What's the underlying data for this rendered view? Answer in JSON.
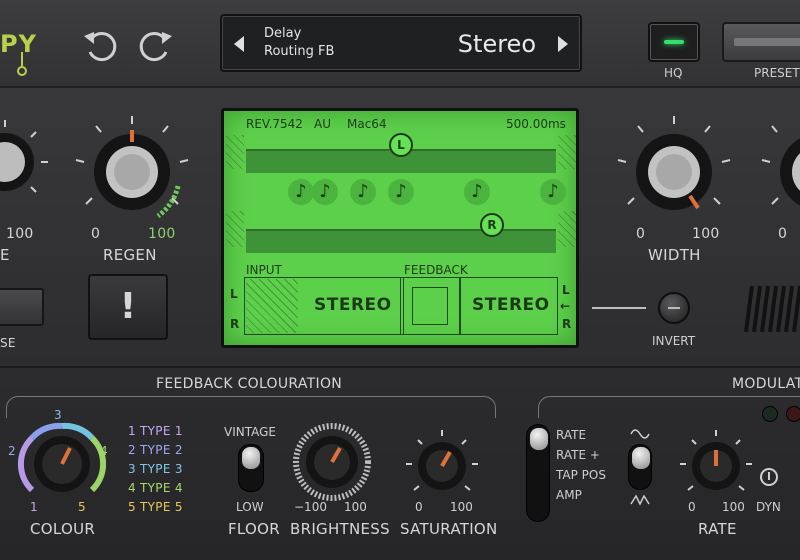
{
  "top_bar": {
    "logo_text": "PY",
    "undo_icon": "undo-arrow-icon",
    "redo_icon": "redo-arrow-icon",
    "preset_display": {
      "line1": "Delay",
      "line2": "Routing FB",
      "value": "Stereo"
    },
    "hq_label": "HQ",
    "presets_label": "PRESETS"
  },
  "left_knobs": {
    "partial_knob_value": "100",
    "partial_knob_label": "E",
    "regen": {
      "label": "REGEN",
      "min": "0",
      "max": "100"
    }
  },
  "left_buttons": {
    "partial_button_label": "SE",
    "warning_symbol": "!"
  },
  "screen": {
    "header_left": [
      "REV.7542",
      "AU",
      "Mac64"
    ],
    "header_right": "500.00ms",
    "marker_left": "L",
    "marker_right": "R",
    "notes": [
      "♪",
      "♪",
      "♪",
      "♪",
      "♪",
      "♪"
    ],
    "input_label": "INPUT",
    "feedback_label": "FEEDBACK",
    "input_mode": "STEREO",
    "feedback_mode": "STEREO",
    "ch_left": "L",
    "ch_right": "R",
    "arrow": "←"
  },
  "right_knobs": {
    "width": {
      "label": "WIDTH",
      "min": "0",
      "max": "100"
    },
    "partial_knob_min": "0",
    "invert_label": "INVERT"
  },
  "feedback_colouration": {
    "title": "FEEDBACK COLOURATION",
    "colour": {
      "label": "COLOUR",
      "scale": [
        "1",
        "2",
        "3",
        "4",
        "5"
      ],
      "types": [
        {
          "label": "1 TYPE 1",
          "color": "#c8a6f0"
        },
        {
          "label": "2 TYPE 2",
          "color": "#9aa8f2"
        },
        {
          "label": "3 TYPE 3",
          "color": "#7fc6e6"
        },
        {
          "label": "4 TYPE 4",
          "color": "#a9d86c"
        },
        {
          "label": "5 TYPE 5",
          "color": "#e8c85a"
        }
      ]
    },
    "floor": {
      "label": "FLOOR",
      "top": "VINTAGE",
      "bottom": "LOW"
    },
    "brightness": {
      "label": "BRIGHTNESS",
      "min": "−100",
      "max": "100"
    },
    "saturation": {
      "label": "SATURATION",
      "min": "0",
      "max": "100"
    }
  },
  "modulation": {
    "title": "MODULAT",
    "modes": [
      "RATE",
      "RATE +",
      "TAP POS",
      "AMP"
    ],
    "wave_up_icon": "sine-wave-icon",
    "wave_down_icon": "triangle-wave-icon",
    "rate": {
      "label": "RATE",
      "min": "0",
      "max": "100"
    },
    "dyn_label": "DYN"
  },
  "colors": {
    "accent_green": "#b8d14a",
    "screen_green": "#5dd04b",
    "hq_led": "#34e06b",
    "knob_pointer": "#e0703a"
  }
}
